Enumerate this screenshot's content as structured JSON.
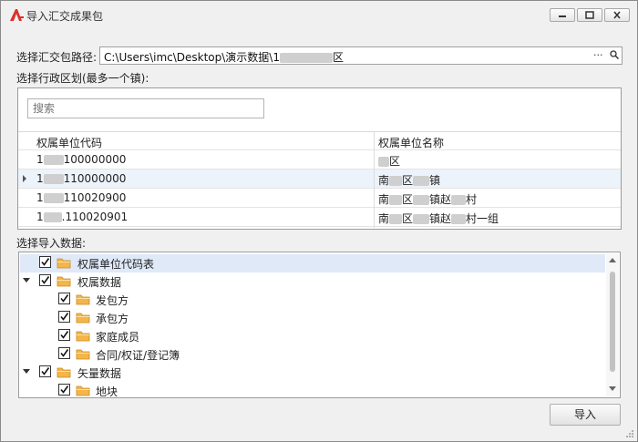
{
  "window": {
    "title": "导入汇交成果包"
  },
  "path": {
    "label": "选择汇交包路径:",
    "value_prefix": "C:\\Users\\imc\\Desktop\\演示数据\\1",
    "value_suffix": "区",
    "browse_label": "···",
    "search_glyph": "🔍"
  },
  "region": {
    "label": "选择行政区划(最多一个镇):",
    "search_placeholder": "搜索",
    "columns": [
      "权属单位代码",
      "权属单位名称"
    ],
    "rows": [
      {
        "code_prefix": "1",
        "code_suffix": "100000000",
        "name_prefix": "",
        "name_mid": "",
        "name_suffix": "区"
      },
      {
        "code_prefix": "1",
        "code_suffix": "110000000",
        "name_prefix": "南",
        "name_mid": "区",
        "name_suffix": "镇"
      },
      {
        "code_prefix": "1",
        "code_suffix": "110020900",
        "name_prefix": "南",
        "name_mid": "区",
        "name_suffix": "镇赵",
        "name_tail": "村"
      },
      {
        "code_prefix": "1",
        "code_suffix": ".110020901",
        "name_prefix": "南",
        "name_mid": "区",
        "name_suffix": "镇赵",
        "name_tail": "村一组"
      }
    ]
  },
  "import_data": {
    "label": "选择导入数据:",
    "tree": [
      {
        "label": "权属单位代码表",
        "checked": true
      },
      {
        "label": "权属数据",
        "checked": true,
        "expanded": true
      },
      {
        "label": "发包方",
        "checked": true
      },
      {
        "label": "承包方",
        "checked": true
      },
      {
        "label": "家庭成员",
        "checked": true
      },
      {
        "label": "合同/权证/登记簿",
        "checked": true
      },
      {
        "label": "矢量数据",
        "checked": true,
        "expanded": true
      },
      {
        "label": "地块",
        "checked": true
      }
    ]
  },
  "actions": {
    "import_label": "导入"
  },
  "colors": {
    "selection": "#dfe9f8",
    "folder": "#f5b54a",
    "app_icon": "#d9322b"
  }
}
